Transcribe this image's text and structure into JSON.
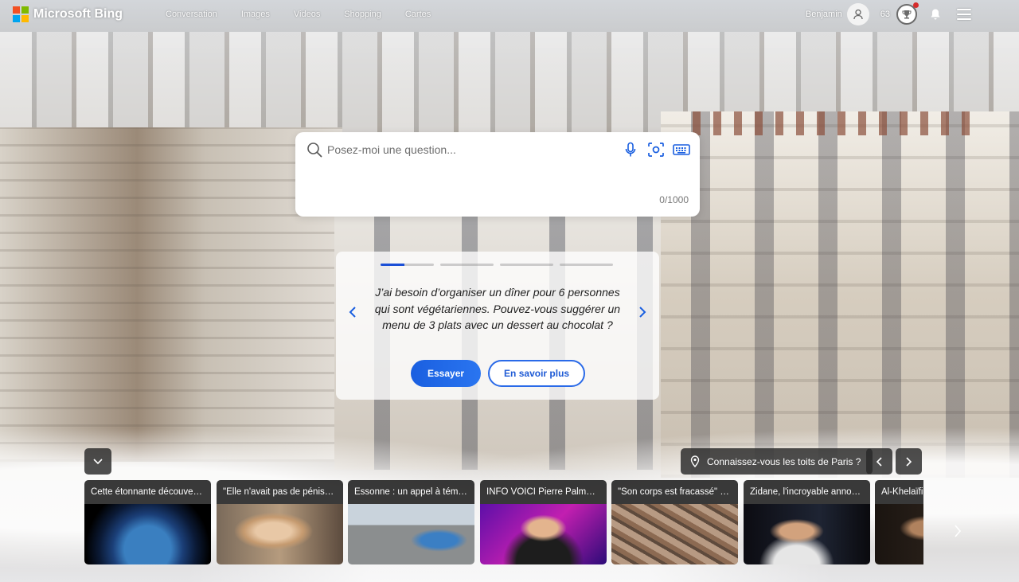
{
  "header": {
    "brand": "Microsoft Bing",
    "nav": [
      "Conversation",
      "Images",
      "Videos",
      "Shopping",
      "Cartes"
    ],
    "user_name": "Benjamin",
    "points": "63"
  },
  "search": {
    "placeholder": "Posez-moi une question...",
    "char_count": "0/1000"
  },
  "suggestion": {
    "text": "J’ai besoin d’organiser un dîner pour 6 personnes qui sont végétariennes. Pouvez-vous suggérer un menu de 3 plats avec un dessert au chocolat ?",
    "try_label": "Essayer",
    "learn_label": "En savoir plus",
    "progress_step": 1,
    "progress_total": 4,
    "progress_fraction": 0.45
  },
  "image_info": {
    "label": "Connaissez-vous les toits de Paris ?"
  },
  "news": [
    {
      "title": "Cette étonnante découverte sur la Terre"
    },
    {
      "title": "\"Elle n'avait pas de pénis\" : Katherine"
    },
    {
      "title": "Essonne : un appel à témoins lancé"
    },
    {
      "title": "INFO VOICI Pierre Palmade"
    },
    {
      "title": "\"Son corps est fracassé\" : le drame"
    },
    {
      "title": "Zidane, l'incroyable annonce"
    },
    {
      "title": "Al-Khelaïfi"
    }
  ],
  "colors": {
    "accent": "#1b4fd6",
    "primary_button": "#1a5fe0",
    "logo": [
      "#f25022",
      "#7fba00",
      "#00a4ef",
      "#ffb900"
    ]
  }
}
